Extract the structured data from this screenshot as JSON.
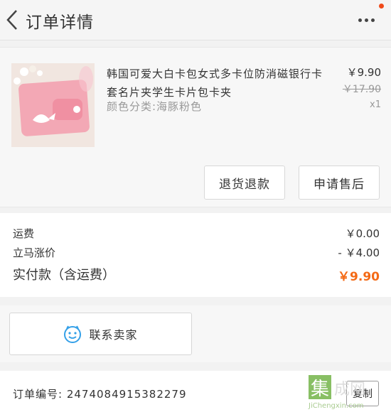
{
  "header": {
    "title": "订单详情",
    "back_icon": "chevron-left-icon",
    "more_icon": "more-dots-icon",
    "notification_color": "#f04a1a"
  },
  "product": {
    "name": "韩国可爱大白卡包女式多卡位防消磁银行卡套名片夹学生卡片包卡夹",
    "sku": "颜色分类:海豚粉色",
    "price": "￥9.90",
    "original_price": "￥17.90",
    "quantity": "x1"
  },
  "actions": {
    "return_label": "退货退款",
    "aftersale_label": "申请售后"
  },
  "summary": {
    "shipping_label": "运费",
    "shipping_value": "￥0.00",
    "discount_label": "立马涨价",
    "discount_value": "- ￥4.00",
    "paid_label": "实付款（含运费）",
    "paid_value": "￥9.90",
    "accent_color": "#f46a16"
  },
  "contact": {
    "label": "联系卖家",
    "icon": "chat-face-icon",
    "icon_color": "#34a0e8"
  },
  "order": {
    "number_label": "订单编号: 2474084915382279",
    "copy_label": "复制"
  },
  "watermark": {
    "box_text": "集",
    "text": "成网",
    "url": "JiChengxin.com"
  }
}
